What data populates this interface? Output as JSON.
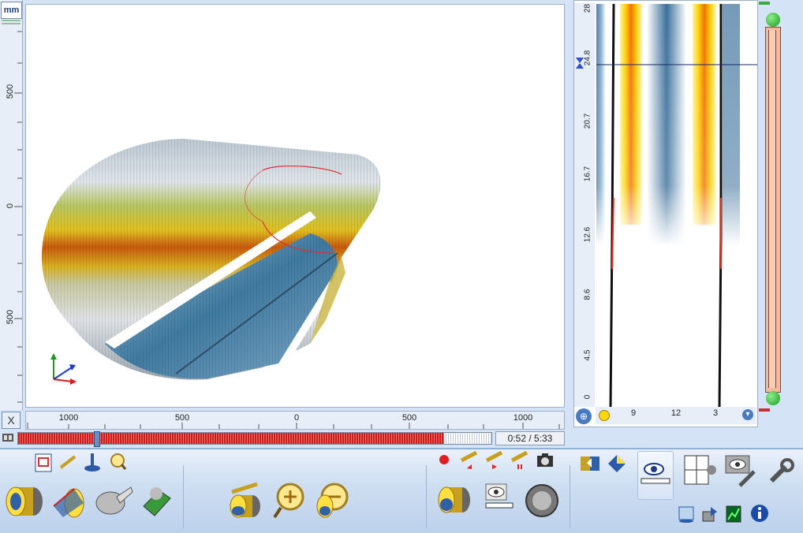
{
  "units_label": "mm",
  "vertical_ruler_ticks": [
    "500",
    "0",
    "500"
  ],
  "horizontal_ruler_ticks": [
    "1000",
    "500",
    "0",
    "500",
    "1000"
  ],
  "close_button_label": "X",
  "playback": {
    "time_display": "0:52 / 5:33",
    "progress": 0.16,
    "buffered": 0.9
  },
  "bscan": {
    "depth_ticks": [
      "28",
      "24.8",
      "20.7",
      "16.7",
      "12.6",
      "8.6",
      "4.5",
      "0"
    ],
    "clock_ticks": [
      "9",
      "12",
      "3"
    ]
  },
  "icons": {
    "top_row": [
      "report-icon",
      "pipe-segment-icon",
      "joystick-icon",
      "zoom-pipe-icon"
    ],
    "record_controls": [
      "record-icon",
      "rewind-icon",
      "play-icon",
      "pause-icon",
      "camera-snapshot-icon"
    ],
    "main_row": [
      "pipe-3d-view-icon",
      "pipe-unroll-icon",
      "hand-measure-icon",
      "pipe-grid-icon",
      "pipe-measure-icon",
      "zoom-in-pipe-icon",
      "zoom-out-pipe-icon",
      "pipe-color-icon",
      "eye-ruler-icon",
      "cross-section-icon"
    ],
    "right_group": [
      "swap-views-icon",
      "layers-icon",
      "eye-ruler-active-icon",
      "clock-grid-icon",
      "eye-settings-icon",
      "wrench-icon",
      "sync-icon",
      "export-icon",
      "green-signal-icon",
      "info-icon"
    ]
  }
}
